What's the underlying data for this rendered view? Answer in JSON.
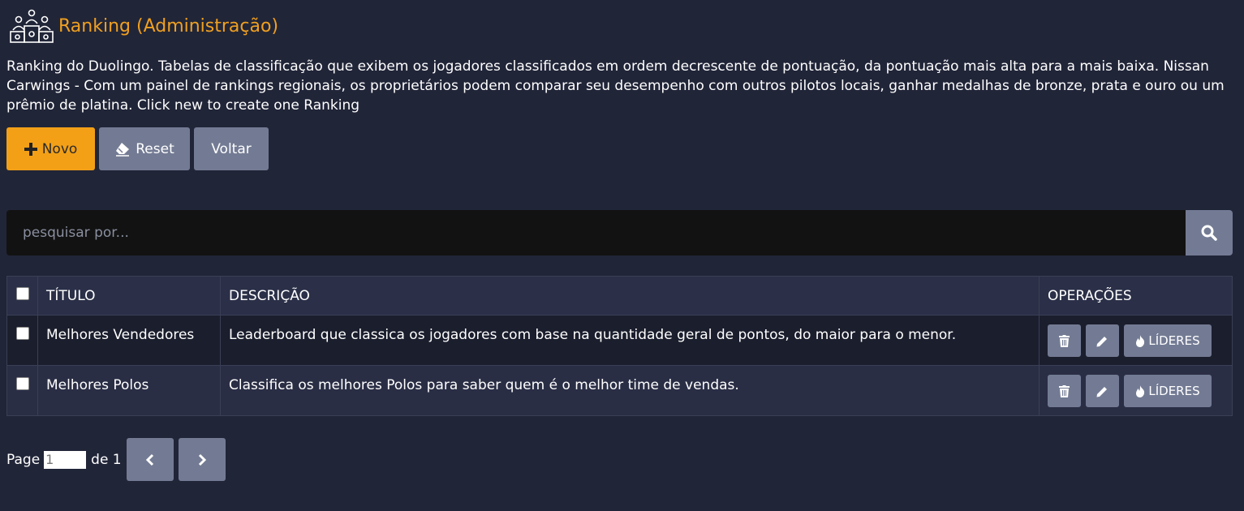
{
  "header": {
    "title": "Ranking (Administração)",
    "icon": "podium-users-icon"
  },
  "description": "Ranking do Duolingo. Tabelas de classificação que exibem os jogadores classificados em ordem decrescente de pontuação, da pontuação mais alta para a mais baixa. Nissan Carwings - Com um painel de rankings regionais, os proprietários podem comparar seu desempenho com outros pilotos locais, ganhar medalhas de bronze, prata e ouro ou um prêmio de platina. Click new to create one Ranking",
  "toolbar": {
    "new_label": "Novo",
    "reset_label": "Reset",
    "back_label": "Voltar"
  },
  "search": {
    "placeholder": "pesquisar por...",
    "value": ""
  },
  "table": {
    "columns": [
      "TÍTULO",
      "DESCRIÇÃO",
      "OPERAÇÕES"
    ],
    "leaders_label": "LÍDERES",
    "rows": [
      {
        "title": "Melhores Vendedores",
        "description": "Leaderboard que classica os jogadores com base na quantidade geral de pontos, do maior para o menor."
      },
      {
        "title": "Melhores Polos",
        "description": "Classifica os melhores Polos para saber quem é o melhor time de vendas."
      }
    ]
  },
  "pagination": {
    "page_label": "Page",
    "current": "1",
    "of_label": "de 1"
  },
  "colors": {
    "background": "#212538",
    "accent": "#f3a017",
    "button_gray": "#737b94",
    "title": "#f0a020"
  }
}
